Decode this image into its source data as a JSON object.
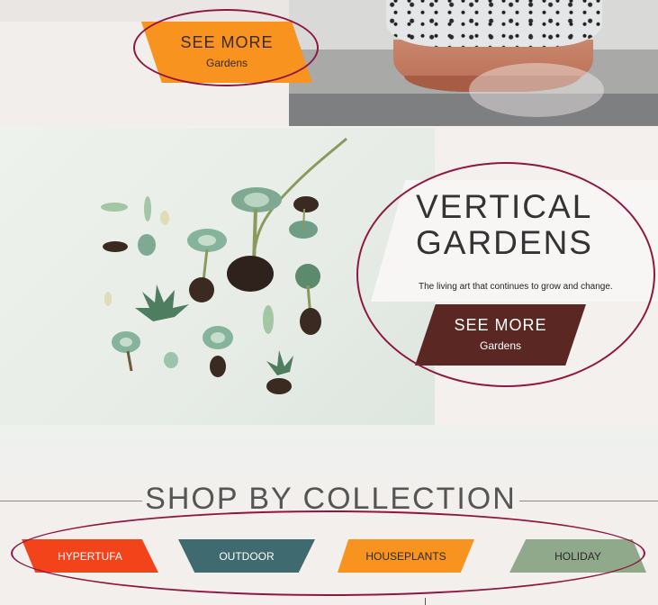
{
  "top_cta": {
    "title": "SEE MORE",
    "subtitle": "Gardens"
  },
  "vertical_gardens": {
    "title_line1": "VERTICAL",
    "title_line2": "GARDENS",
    "tagline": "The living art that continues to grow and change.",
    "cta": {
      "title": "SEE MORE",
      "subtitle": "Gardens"
    }
  },
  "shop_by_collection": {
    "heading": "SHOP BY COLLECTION",
    "collections": [
      {
        "label": "HYPERTUFA",
        "color": "#f2431a"
      },
      {
        "label": "OUTDOOR",
        "color": "#3f6a6f"
      },
      {
        "label": "HOUSEPLANTS",
        "color": "#f7931e"
      },
      {
        "label": "HOLIDAY",
        "color": "#90a98a"
      }
    ]
  },
  "colors": {
    "highlight_ring": "#8e1744",
    "cta_orange": "#f7931e",
    "cta_brown": "#5a2722"
  }
}
